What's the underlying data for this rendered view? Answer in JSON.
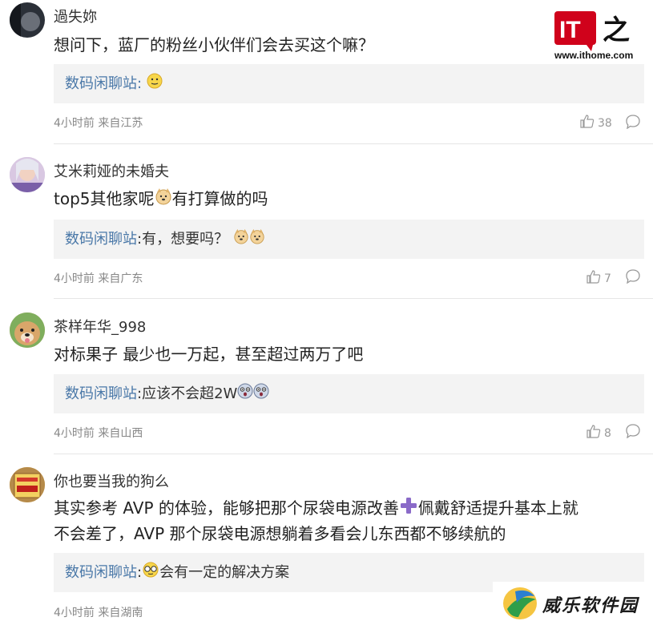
{
  "brand": {
    "logo_text": "IT之家",
    "logo_mark": "IT",
    "url": "www.ithome.com",
    "accent": "#d0021b"
  },
  "watermark": {
    "text": "威乐软件园"
  },
  "colors": {
    "reply_user": "#4a78a8",
    "reply_bg": "#f3f3f3",
    "meta": "#888888"
  },
  "reply_label": "数码闲聊站",
  "comments": [
    {
      "user": "過失妳",
      "text": "想问下，蓝厂的粉丝小伙伴们会去买这个嘛？",
      "reply": ":",
      "reply_emoji": "smile-emoji",
      "time": "4小时前 来自江苏",
      "likes": "38"
    },
    {
      "user": "艾米莉娅的未婚夫",
      "text_a": "top5其他家呢",
      "text_b": "有打算做的吗",
      "reply": ":有，想要吗？",
      "time": "4小时前 来自广东",
      "likes": "7"
    },
    {
      "user": "茶样年华_998",
      "text": "对标果子 最少也一万起，甚至超过两万了吧",
      "reply": ":应该不会超2W",
      "time": "4小时前 来自山西",
      "likes": "8"
    },
    {
      "user": "你也要当我的狗么",
      "text_line1": "其实参考 AVP 的体验，能够把那个尿袋电源改善",
      "text_line1b": "佩戴舒适提升基本上就",
      "text_line2": "不会差了，AVP 那个尿袋电源想躺着多看会儿东西都不够续航的",
      "reply_a": ":",
      "reply_b": "会有一定的解决方案",
      "time": "4小时前 来自湖南"
    }
  ]
}
